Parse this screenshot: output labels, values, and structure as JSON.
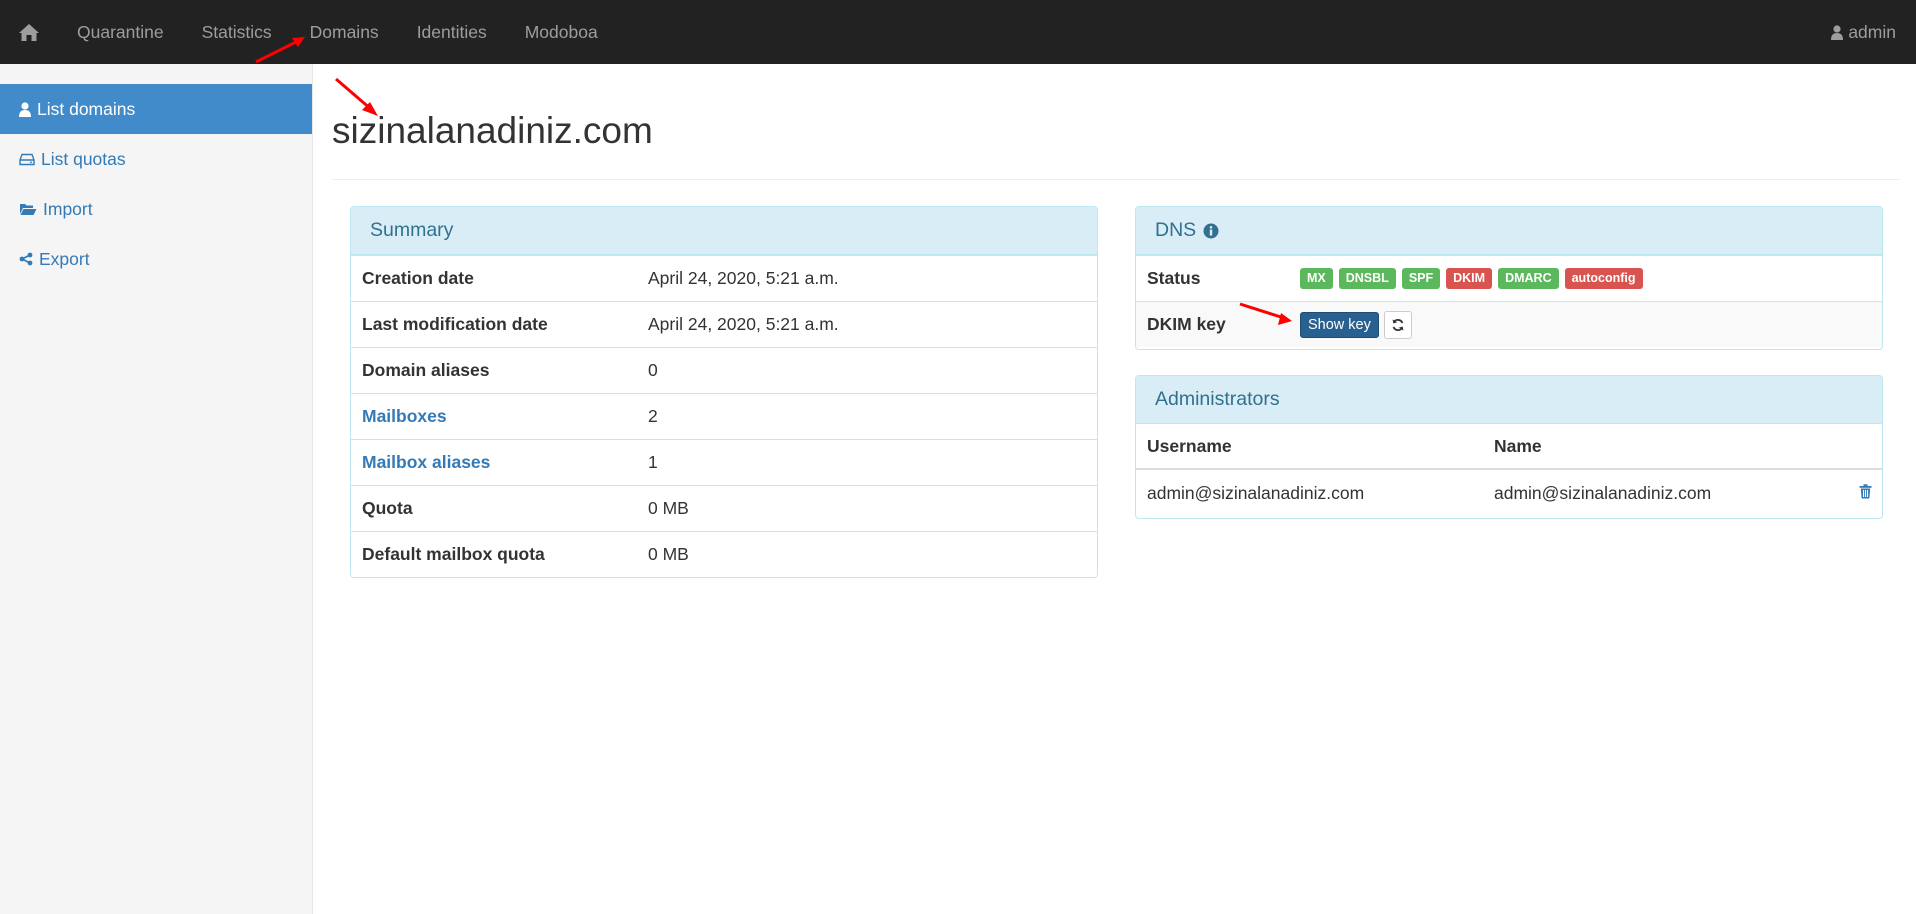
{
  "navbar": {
    "items": [
      "Quarantine",
      "Statistics",
      "Domains",
      "Identities",
      "Modoboa"
    ],
    "user": "admin"
  },
  "sidebar": {
    "items": [
      {
        "label": "List domains",
        "icon": "user-icon",
        "active": true
      },
      {
        "label": "List quotas",
        "icon": "hdd-icon"
      },
      {
        "label": "Import",
        "icon": "folder-open-icon"
      },
      {
        "label": "Export",
        "icon": "share-icon"
      }
    ]
  },
  "page": {
    "title": "sizinalanadiniz.com"
  },
  "summary": {
    "heading": "Summary",
    "rows": [
      {
        "label": "Creation date",
        "value": "April 24, 2020, 5:21 a.m."
      },
      {
        "label": "Last modification date",
        "value": "April 24, 2020, 5:21 a.m."
      },
      {
        "label": "Domain aliases",
        "value": "0"
      },
      {
        "label": "Mailboxes",
        "value": "2"
      },
      {
        "label": "Mailbox aliases",
        "value": "1"
      },
      {
        "label": "Quota",
        "value": "0 MB"
      },
      {
        "label": "Default mailbox quota",
        "value": "0 MB"
      }
    ]
  },
  "dns": {
    "heading": "DNS",
    "status_label": "Status",
    "badges": [
      {
        "text": "MX",
        "state": "ok"
      },
      {
        "text": "DNSBL",
        "state": "ok"
      },
      {
        "text": "SPF",
        "state": "ok"
      },
      {
        "text": "DKIM",
        "state": "bad"
      },
      {
        "text": "DMARC",
        "state": "ok"
      },
      {
        "text": "autoconfig",
        "state": "bad"
      }
    ],
    "dkim_label": "DKIM key",
    "show_key": "Show key"
  },
  "admins": {
    "heading": "Administrators",
    "columns": [
      "Username",
      "Name"
    ],
    "rows": [
      {
        "username": "admin@sizinalanadiniz.com",
        "name": "admin@sizinalanadiniz.com"
      }
    ]
  },
  "colors": {
    "navbar": "#222222",
    "accent": "#428bca",
    "ok": "#5cb85c",
    "bad": "#d9534f",
    "annotation": "#ff0000"
  }
}
